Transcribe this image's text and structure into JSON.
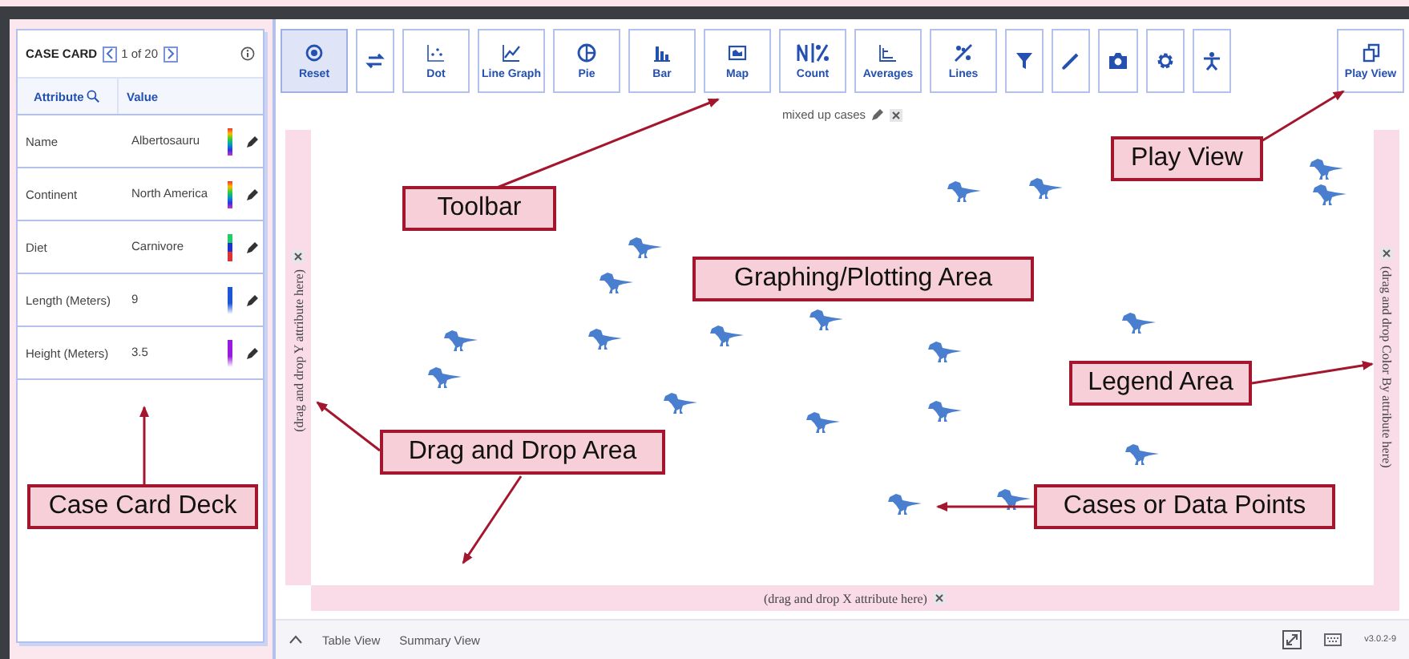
{
  "case_card": {
    "title": "CASE CARD",
    "position": "1 of 20",
    "columns": [
      "Attribute",
      "Value"
    ],
    "rows": [
      {
        "attribute": "Name",
        "value": "Albertosauru",
        "kind": "categorical"
      },
      {
        "attribute": "Continent",
        "value": "North America",
        "kind": "categorical"
      },
      {
        "attribute": "Diet",
        "value": "Carnivore",
        "kind": "diverging"
      },
      {
        "attribute": "Length (Meters)",
        "value": "9",
        "kind": "numeric",
        "color": "#1e56d8"
      },
      {
        "attribute": "Height (Meters)",
        "value": "3.5",
        "kind": "numeric",
        "color": "#9a1be0"
      }
    ]
  },
  "graph": {
    "toolbar": [
      {
        "label": "Reset",
        "selected": true
      },
      {
        "selected": false
      },
      {
        "label": "Dot",
        "selected": false
      },
      {
        "label": "Line Graph",
        "selected": false
      },
      {
        "label": "Pie",
        "selected": false
      },
      {
        "label": "Bar",
        "selected": false
      },
      {
        "label": "Map",
        "selected": false
      },
      {
        "label": "Count",
        "selected": false
      },
      {
        "label": "Averages",
        "selected": false
      },
      {
        "label": "Lines",
        "selected": false
      },
      {
        "selected": false
      },
      {
        "selected": false
      },
      {
        "selected": false
      },
      {
        "selected": false
      },
      {
        "selected": false
      }
    ],
    "play_view": "Play View",
    "title": "mixed up cases",
    "y_drop": "(drag and drop Y attribute here)",
    "legend_drop": "(drag and drop Color By attribute here)",
    "x_drop": "(drag and drop X attribute here)"
  },
  "bottom_bar": {
    "tabs": [
      "Table View",
      "Summary View"
    ],
    "version": "v3.0.2-9"
  },
  "annotations": [
    {
      "label": "Toolbar"
    },
    {
      "label": "Play View"
    },
    {
      "label": "Graphing/Plotting Area"
    },
    {
      "label": "Legend Area"
    },
    {
      "label": "Drag and Drop Area"
    },
    {
      "label": "Case Card Deck"
    },
    {
      "label": "Cases or Data Points"
    }
  ]
}
